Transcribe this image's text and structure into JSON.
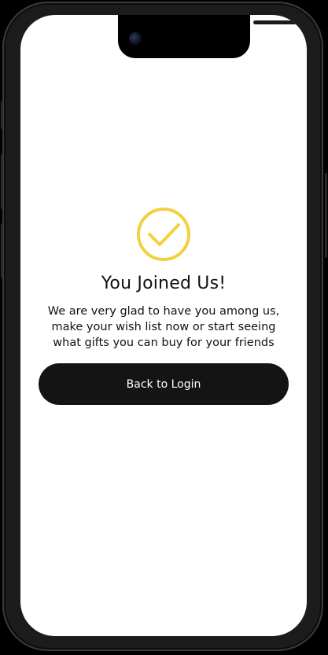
{
  "screen": {
    "title": "You Joined Us!",
    "message": "We are very glad to have you among us, make your wish list now or start seeing what gifts you can buy for your friends",
    "back_button_label": "Back to Login"
  },
  "icons": {
    "success": "check-circle-icon"
  },
  "colors": {
    "accent": "#F4D03F",
    "button_background": "#141414",
    "button_text": "#FFFFFF",
    "screen_background": "#FFFFFF",
    "text": "#111111"
  }
}
